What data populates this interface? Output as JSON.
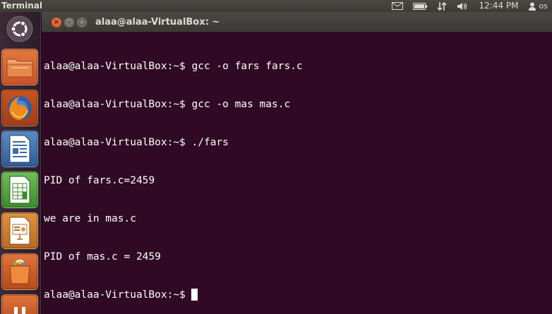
{
  "panel": {
    "app_name": "Terminal",
    "clock": "12:44 PM",
    "user": "os",
    "icons": [
      "mail-icon",
      "battery-icon",
      "network-icon",
      "volume-icon",
      "user-icon"
    ]
  },
  "launcher": {
    "items": [
      {
        "name": "dash-home",
        "icon": "ubuntu-logo-icon"
      },
      {
        "name": "home-folder",
        "icon": "folder-icon"
      },
      {
        "name": "firefox",
        "icon": "firefox-icon"
      },
      {
        "name": "libreoffice-writer",
        "icon": "writer-icon"
      },
      {
        "name": "libreoffice-calc",
        "icon": "calc-icon"
      },
      {
        "name": "libreoffice-impress",
        "icon": "impress-icon"
      },
      {
        "name": "software-center",
        "icon": "shopping-bag-icon"
      },
      {
        "name": "extra-app",
        "icon": "app-icon"
      }
    ]
  },
  "window": {
    "title": "alaa@alaa-VirtualBox: ~",
    "buttons": {
      "close": "×",
      "minimize": "–",
      "maximize": "□"
    }
  },
  "terminal": {
    "lines": [
      "alaa@alaa-VirtualBox:~$ gcc -o fars fars.c",
      "alaa@alaa-VirtualBox:~$ gcc -o mas mas.c",
      "alaa@alaa-VirtualBox:~$ ./fars",
      "PID of fars.c=2459",
      "we are in mas.c",
      "PID of mas.c = 2459"
    ],
    "prompt": "alaa@alaa-VirtualBox:~$"
  },
  "colors": {
    "terminal_bg": "#300a24",
    "terminal_fg": "#ffffff",
    "close_button": "#e65b2b"
  }
}
